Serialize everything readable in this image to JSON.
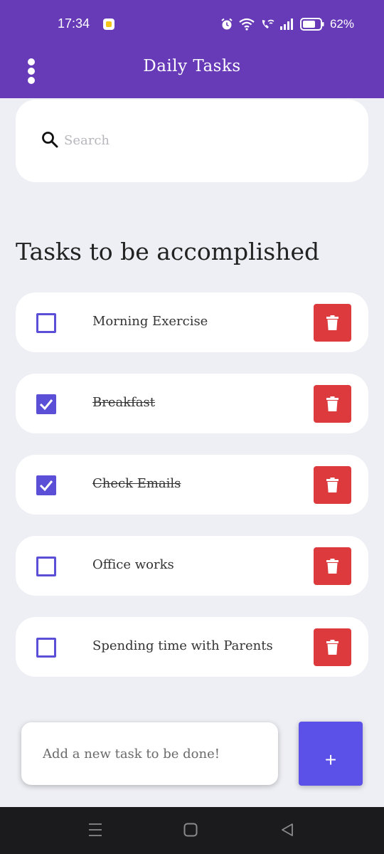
{
  "status_bar": {
    "time": "17:34",
    "battery": "62%"
  },
  "app_bar": {
    "title": "Daily Tasks"
  },
  "search": {
    "placeholder": "Search"
  },
  "section_title": "Tasks to be accomplished",
  "tasks": [
    {
      "label": "Morning Exercise",
      "done": false
    },
    {
      "label": "Breakfast",
      "done": true
    },
    {
      "label": "Check Emails",
      "done": true
    },
    {
      "label": "Office works",
      "done": false
    },
    {
      "label": "Spending time with Parents",
      "done": false
    }
  ],
  "new_task": {
    "placeholder": "Add a new task to be done!",
    "add_label": "+"
  },
  "colors": {
    "primary": "#673ab7",
    "accent": "#5b50e8",
    "delete": "#dc3a3c",
    "background": "#eeeff4"
  },
  "icons": {
    "menu": "more-vert-icon",
    "search": "search-icon",
    "delete": "trash-icon",
    "checkbox": "checkbox-icon"
  }
}
